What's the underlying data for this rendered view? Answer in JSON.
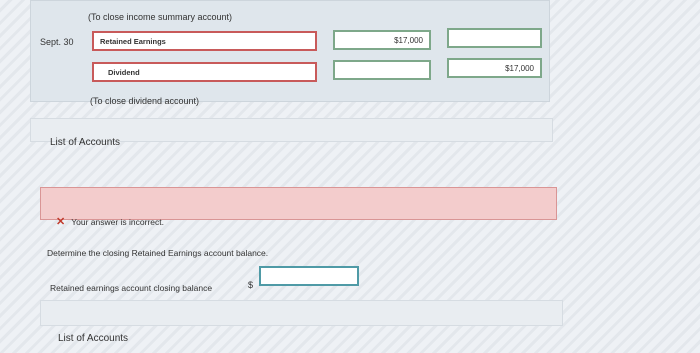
{
  "journal": {
    "income_summary_note": "(To close income summary account)",
    "date": "Sept. 30",
    "row1": {
      "account": "Retained Earnings",
      "debit": "$17,000",
      "credit": ""
    },
    "row2": {
      "account": "Dividend",
      "debit": "",
      "credit": "$17,000"
    },
    "dividend_note": "(To close dividend account)"
  },
  "list_accounts_1": "List of Accounts",
  "feedback": {
    "message": "Your answer is incorrect."
  },
  "question": "Determine the closing Retained Earnings account balance.",
  "answer": {
    "label": "Retained earnings account closing balance",
    "currency": "$",
    "value": ""
  },
  "list_accounts_2": "List of Accounts"
}
